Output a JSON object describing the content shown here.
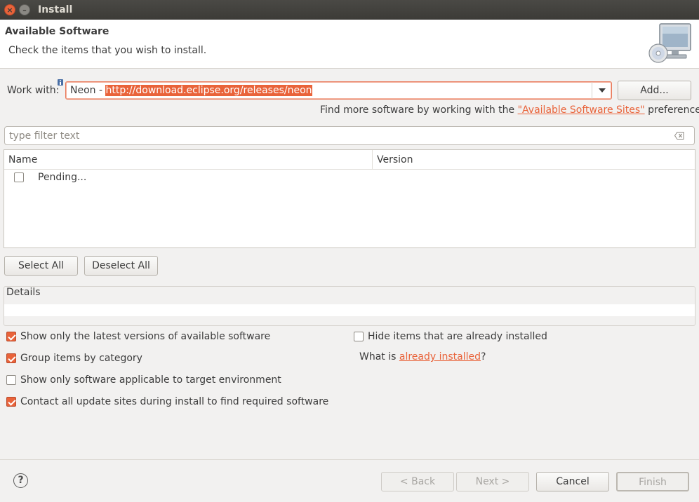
{
  "window": {
    "title": "Install"
  },
  "banner": {
    "heading": "Available Software",
    "subtitle": "Check the items that you wish to install."
  },
  "work_with": {
    "label": "Work with:",
    "site_name": "Neon - ",
    "site_url": "http://download.eclipse.org/releases/neon",
    "add_button": "Add..."
  },
  "more_software": {
    "prefix": "Find more software by working with the ",
    "link": "\"Available Software Sites\"",
    "suffix": " preferences."
  },
  "filter": {
    "placeholder": "type filter text"
  },
  "table": {
    "columns": [
      "Name",
      "Version"
    ],
    "rows": [
      {
        "name": "Pending...",
        "version": "",
        "checked": false
      }
    ]
  },
  "selection_buttons": {
    "select_all": "Select All",
    "deselect_all": "Deselect All"
  },
  "details": {
    "title": "Details"
  },
  "options": {
    "show_latest": {
      "label": "Show only the latest versions of available software",
      "checked": true
    },
    "hide_installed": {
      "label": "Hide items that are already installed",
      "checked": false
    },
    "group_by_category": {
      "label": "Group items by category",
      "checked": true
    },
    "what_is_prefix": "What is ",
    "what_is_link": "already installed",
    "what_is_suffix": "?",
    "show_applicable": {
      "label": "Show only software applicable to target environment",
      "checked": false
    },
    "contact_sites": {
      "label": "Contact all update sites during install to find required software",
      "checked": true
    }
  },
  "footer": {
    "back": "< Back",
    "next": "Next >",
    "cancel": "Cancel",
    "finish": "Finish"
  },
  "colors": {
    "accent": "#e9633a",
    "titlebar": "#3c3b37",
    "background": "#f2f1f0"
  }
}
